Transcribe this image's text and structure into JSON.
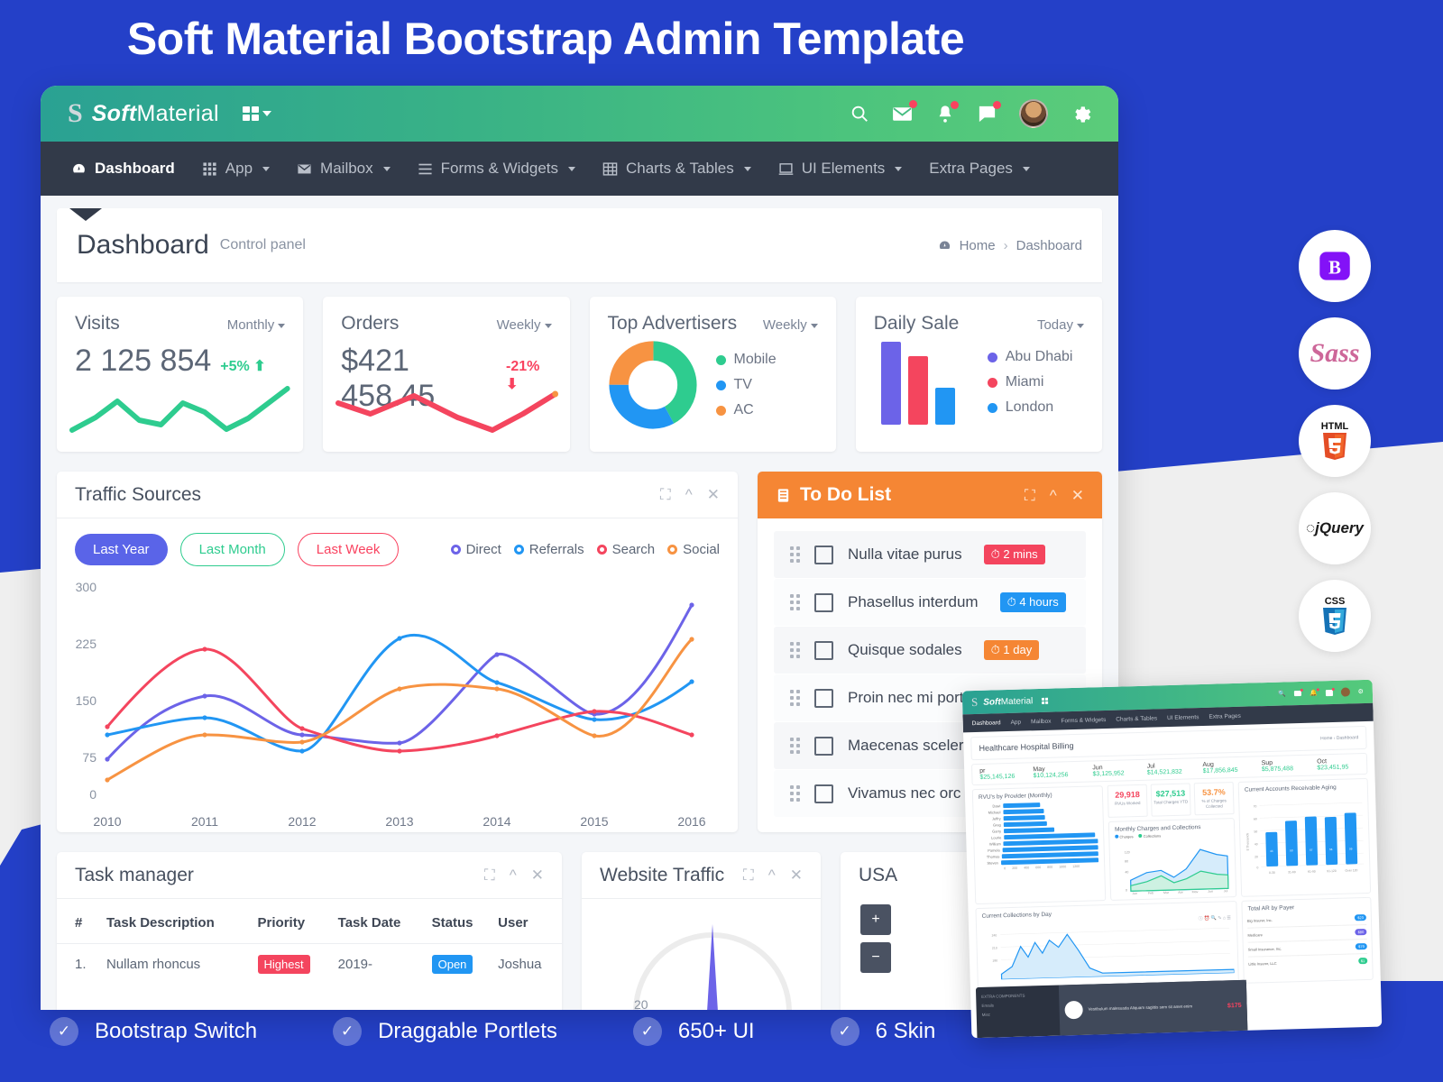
{
  "hero": {
    "title": "Soft Material Bootstrap Admin Template"
  },
  "topbar": {
    "brand_bold": "Soft",
    "brand_rest": "Material",
    "icons": [
      "search-icon",
      "mail-icon",
      "bell-icon",
      "chat-icon",
      "avatar",
      "gear-icon"
    ]
  },
  "menu": {
    "items": [
      {
        "label": "Dashboard",
        "icon": "dashboard-icon",
        "active": true,
        "caret": false
      },
      {
        "label": "App",
        "icon": "grid-icon",
        "active": false,
        "caret": true
      },
      {
        "label": "Mailbox",
        "icon": "envelope-icon",
        "active": false,
        "caret": true
      },
      {
        "label": "Forms & Widgets",
        "icon": "list-icon",
        "active": false,
        "caret": true
      },
      {
        "label": "Charts & Tables",
        "icon": "table-icon",
        "active": false,
        "caret": true
      },
      {
        "label": "UI Elements",
        "icon": "monitor-icon",
        "active": false,
        "caret": true
      },
      {
        "label": "Extra Pages",
        "icon": "",
        "active": false,
        "caret": true
      }
    ]
  },
  "page_head": {
    "title": "Dashboard",
    "subtitle": "Control panel",
    "breadcrumb_home": "Home",
    "breadcrumb_sep": "›",
    "breadcrumb_current": "Dashboard"
  },
  "stats": [
    {
      "title": "Visits",
      "period": "Monthly",
      "value": "2 125 854",
      "delta": "+5%",
      "direction": "up",
      "accent": "#2ecc8f"
    },
    {
      "title": "Orders",
      "period": "Weekly",
      "value": "$421 458.45",
      "delta": "-21%",
      "direction": "down",
      "accent": "#f9425f"
    }
  ],
  "advertisers": {
    "title": "Top Advertisers",
    "period": "Weekly",
    "legend": [
      {
        "label": "Mobile",
        "color": "#2ecc8f"
      },
      {
        "label": "TV",
        "color": "#2196f3"
      },
      {
        "label": "AC",
        "color": "#f79342"
      }
    ]
  },
  "daily_sale": {
    "title": "Daily Sale",
    "period": "Today",
    "legend": [
      {
        "label": "Abu Dhabi",
        "color": "#6c63e8"
      },
      {
        "label": "Miami",
        "color": "#f9425f"
      },
      {
        "label": "London",
        "color": "#2196f3"
      }
    ]
  },
  "traffic": {
    "title": "Traffic Sources",
    "tools": [
      "expand-icon",
      "collapse-icon",
      "close-icon"
    ],
    "tabs": [
      {
        "label": "Last Year",
        "style": "solid"
      },
      {
        "label": "Last Month",
        "style": "out-green"
      },
      {
        "label": "Last Week",
        "style": "out-red"
      }
    ]
  },
  "todo": {
    "title": "To Do List",
    "icon": "clipboard-icon",
    "tools": [
      "expand-icon",
      "collapse-icon",
      "close-icon"
    ],
    "items": [
      {
        "text": "Nulla vitae purus",
        "badge": "2 mins",
        "badge_color": "#f9425f"
      },
      {
        "text": "Phasellus interdum",
        "badge": "4 hours",
        "badge_color": "#2196f3"
      },
      {
        "text": "Quisque sodales",
        "badge": "1 day",
        "badge_color": "#f58634"
      },
      {
        "text": "Proin nec mi porta",
        "badge": "",
        "badge_color": ""
      },
      {
        "text": "Maecenas sceler",
        "badge": "",
        "badge_color": ""
      },
      {
        "text": "Vivamus nec orc",
        "badge": "",
        "badge_color": ""
      }
    ]
  },
  "task_manager": {
    "title": "Task manager",
    "tools": [
      "expand-icon",
      "collapse-icon",
      "close-icon"
    ],
    "columns": [
      "#",
      "Task Description",
      "Priority",
      "Task Date",
      "Status",
      "User"
    ],
    "rows": [
      {
        "num": "1.",
        "desc": "Nullam rhoncus",
        "priority": "Highest",
        "priority_color": "#f9425f",
        "date": "2019-",
        "status": "Open",
        "status_color": "#2196f3",
        "user": "Joshua"
      }
    ]
  },
  "website_traffic": {
    "title": "Website Traffic",
    "tools": [
      "expand-icon",
      "collapse-icon",
      "close-icon"
    ],
    "gauge_tick": "20"
  },
  "usa_panel": {
    "title": "USA",
    "zoom_in": "+",
    "zoom_out": "−"
  },
  "tech_badges": [
    {
      "name": "bootstrap-icon",
      "label": "B"
    },
    {
      "name": "sass-icon",
      "label": "Sass"
    },
    {
      "name": "html5-icon",
      "label": "HTML"
    },
    {
      "name": "jquery-icon",
      "label": "jQuery"
    },
    {
      "name": "css3-icon",
      "label": "CSS"
    }
  ],
  "inset": {
    "brand_bold": "Soft",
    "brand_rest": "Material",
    "menu": [
      "Dashboard",
      "App",
      "Mailbox",
      "Forms & Widgets",
      "Charts & Tables",
      "UI Elements",
      "Extra Pages"
    ],
    "page_title": "Healthcare Hospital Billing",
    "breadcrumb": "Home  ›  Dashboard",
    "kpis": [
      {
        "label": "pr",
        "value": "$25,145,126"
      },
      {
        "label": "May",
        "value": "$10,124,256"
      },
      {
        "label": "Jun",
        "value": "$3,125,952"
      },
      {
        "label": "Jul",
        "value": "$14,521,832"
      },
      {
        "label": "Aug",
        "value": "$17,856,845"
      },
      {
        "label": "Sup",
        "value": "$5,875,488"
      },
      {
        "label": "Oct",
        "value": "$23,451,95"
      }
    ],
    "rvu_title": "RVU's by Provider (Monthly)",
    "rvu_rows": [
      {
        "name": "Dawi",
        "value": "400"
      },
      {
        "name": "Michael",
        "value": "433"
      },
      {
        "name": "Jeffry",
        "value": "449"
      },
      {
        "name": "Greg",
        "value": "472"
      },
      {
        "name": "Garry",
        "value": "546"
      },
      {
        "name": "Lourie",
        "value": "988"
      },
      {
        "name": "William",
        "value": "1057"
      },
      {
        "name": "Pamela",
        "value": "1132"
      },
      {
        "name": "Thomas",
        "value": "1168"
      },
      {
        "name": "Steven",
        "value": "1280"
      }
    ],
    "kpi_boxes": [
      {
        "num": "29,918",
        "label": "RVUs Worked",
        "color": "#f9425f"
      },
      {
        "num": "$27,513",
        "label": "Total Charges YTD",
        "color": "#2ecc8f"
      },
      {
        "num": "53.7%",
        "label": "% of Charges Collected",
        "color": "#f79342"
      }
    ],
    "charges_title": "Monthly Charges and Collections",
    "charges_legend": [
      "Charges",
      "Collections"
    ],
    "charges_months": [
      "Jan",
      "Feb",
      "Mar",
      "Apr",
      "May",
      "Jun",
      "Jul"
    ],
    "ar_title": "Current Accounts Receivable Aging",
    "ar_categories": [
      "0-30",
      "31-60",
      "61-90",
      "91-120",
      "Over 120"
    ],
    "ar_values": [
      44,
      53,
      57,
      56,
      59
    ],
    "ar_ylabel": "$ Thousands",
    "collections_title": "Current Collections by Day",
    "payer_title": "Total AR by Payer",
    "payer_rows": [
      {
        "name": "Big Insurer, Inc.",
        "badge": "$23",
        "color": "#2196f3"
      },
      {
        "name": "Medicare",
        "badge": "$80",
        "color": "#6c63e8"
      },
      {
        "name": "Small Insurance, Inc.",
        "badge": "$79",
        "color": "#2196f3"
      },
      {
        "name": "Little Insurer, LLC",
        "badge": "$1",
        "color": "#2ecc8f"
      }
    ],
    "footer_heading": "EXTRA COMPONENTS",
    "footer_items": [
      "Emails",
      "Misc"
    ],
    "note_text": "Vestibulum malesuada Aliquam sagittis sem sit amet enim",
    "note_price": "$175"
  },
  "features": [
    {
      "label": "Bootstrap Switch",
      "icon": "check-icon"
    },
    {
      "label": "Draggable Portlets",
      "icon": "check-icon"
    },
    {
      "label": "650+ UI",
      "icon": "check-icon"
    },
    {
      "label": "6 Skin",
      "icon": "check-icon"
    }
  ],
  "chart_data": [
    {
      "type": "line",
      "title": "Traffic Sources",
      "x": [
        "2010",
        "2011",
        "2012",
        "2013",
        "2014",
        "2015",
        "2016"
      ],
      "ylim": [
        0,
        300
      ],
      "yticks": [
        0,
        75,
        150,
        225,
        300
      ],
      "grid": false,
      "legend_position": "top-right",
      "series": [
        {
          "name": "Direct",
          "color": "#6c63e8",
          "values": [
            47,
            130,
            78,
            70,
            185,
            107,
            250
          ]
        },
        {
          "name": "Referrals",
          "color": "#2196f3",
          "values": [
            80,
            102,
            58,
            207,
            148,
            100,
            150
          ]
        },
        {
          "name": "Search",
          "color": "#f9425f",
          "values": [
            90,
            192,
            88,
            58,
            78,
            110,
            80
          ]
        },
        {
          "name": "Social",
          "color": "#f79342",
          "values": [
            20,
            79,
            70,
            140,
            140,
            78,
            205
          ]
        }
      ]
    },
    {
      "type": "pie",
      "title": "Top Advertisers",
      "labels": [
        "Mobile",
        "TV",
        "AC"
      ],
      "values": [
        42,
        33,
        25
      ],
      "colors": [
        "#2ecc8f",
        "#2196f3",
        "#f79342"
      ],
      "legend_position": "right"
    },
    {
      "type": "bar",
      "title": "Daily Sale",
      "categories": [
        "Abu Dhabi",
        "Miami",
        "London"
      ],
      "values": [
        100,
        82,
        44
      ],
      "colors": [
        "#6c63e8",
        "#f9425f",
        "#2196f3"
      ],
      "ylim": [
        0,
        100
      ],
      "grid": false
    },
    {
      "type": "line",
      "title": "Visits sparkline",
      "values": [
        18,
        38,
        52,
        30,
        22,
        50,
        44,
        20,
        30,
        62
      ],
      "color": "#2ecc8f",
      "ylim": [
        0,
        70
      ]
    },
    {
      "type": "line",
      "title": "Orders sparkline",
      "values": [
        48,
        36,
        40,
        58,
        42,
        26,
        18,
        30,
        46,
        58
      ],
      "color": "#f9425f",
      "ylim": [
        0,
        70
      ]
    },
    {
      "type": "bar",
      "title": "Current Accounts Receivable Aging",
      "categories": [
        "0-30",
        "31-60",
        "61-90",
        "91-120",
        "Over 120"
      ],
      "values": [
        44,
        53,
        57,
        56,
        59
      ],
      "ylabel": "$ Thousands",
      "ylim": [
        0,
        70
      ],
      "color": "#2196f3"
    },
    {
      "type": "bar",
      "title": "RVU's by Provider (Monthly)",
      "categories": [
        "Dawi",
        "Michael",
        "Jeffry",
        "Greg",
        "Garry",
        "Lourie",
        "William",
        "Pamela",
        "Thomas",
        "Steven"
      ],
      "values": [
        400,
        433,
        449,
        472,
        546,
        988,
        1057,
        1132,
        1168,
        1280
      ],
      "xlim": [
        0,
        1280
      ],
      "color": "#2196f3"
    }
  ]
}
